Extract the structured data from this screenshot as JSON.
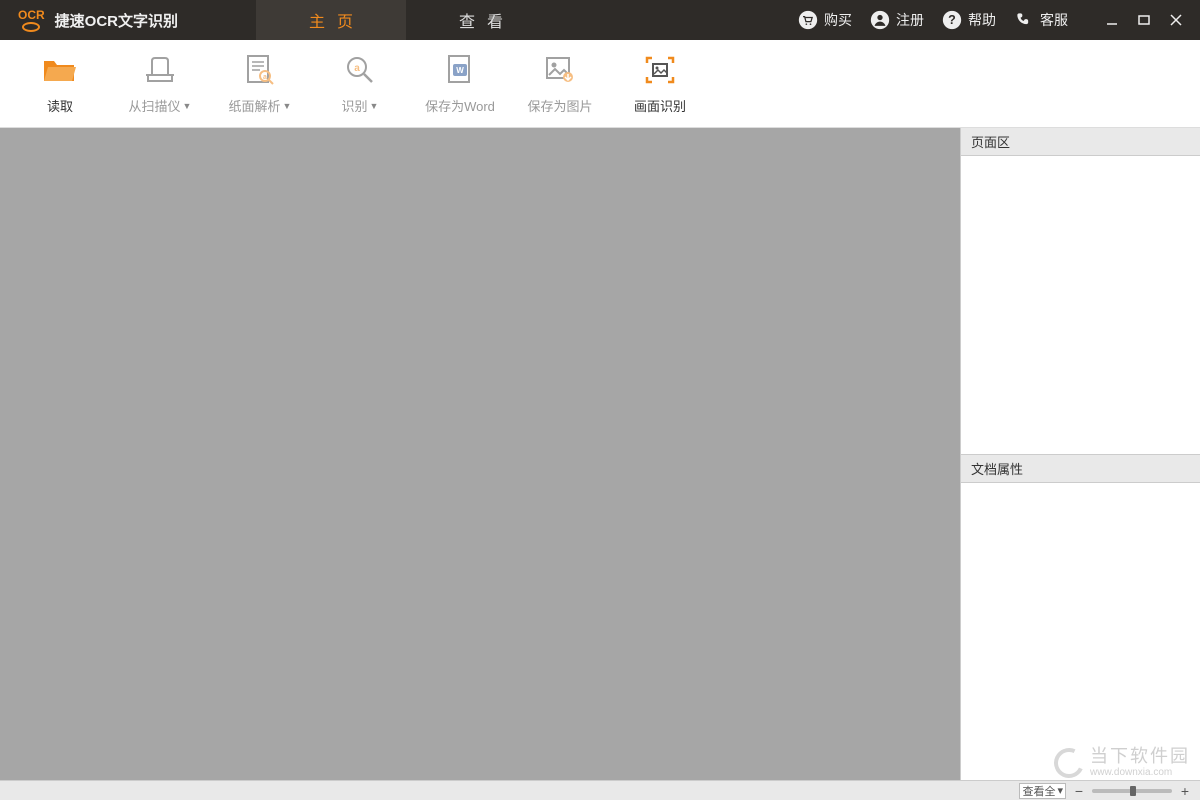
{
  "app": {
    "logo_small": "OCR",
    "title": "捷速OCR文字识别"
  },
  "tabs": {
    "home": "主页",
    "view": "查看"
  },
  "title_actions": {
    "buy": "购买",
    "register": "注册",
    "help": "帮助",
    "service": "客服"
  },
  "toolbar": {
    "read": "读取",
    "scanner": "从扫描仪",
    "analyze": "纸面解析",
    "recognize": "识别",
    "save_word": "保存为Word",
    "save_image": "保存为图片",
    "screen_ocr": "画面识别"
  },
  "sidebar": {
    "pages_panel": "页面区",
    "props_panel": "文档属性"
  },
  "status": {
    "zoom_label": "查看全",
    "zoom_dd": "▾"
  },
  "watermark": {
    "main": "当下软件园",
    "sub": "www.downxia.com"
  }
}
